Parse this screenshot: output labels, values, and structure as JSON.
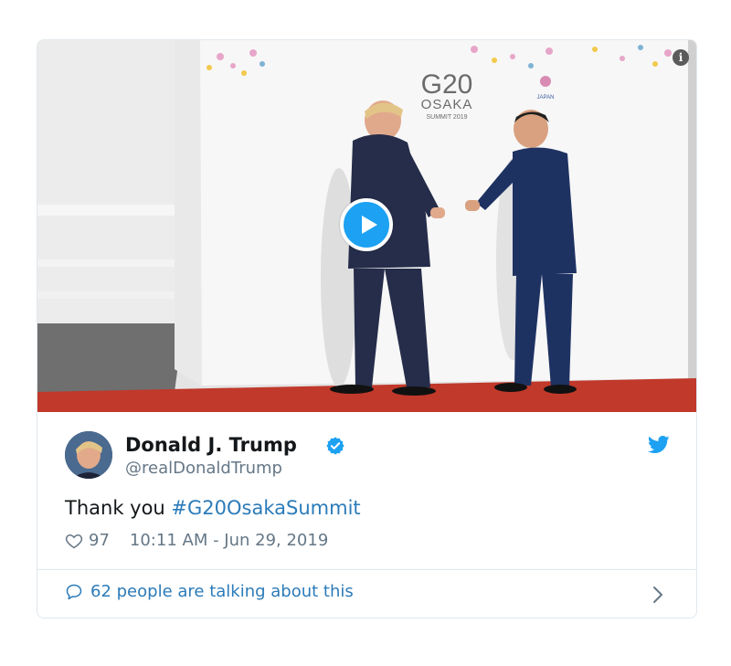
{
  "tweet": {
    "name": "Donald J. Trump",
    "handle": "@realDonaldTrump",
    "text_prefix": "Thank you ",
    "hashtag": "#G20OsakaSummit",
    "likes": "97",
    "timestamp": "10:11 AM - Jun 29, 2019",
    "talking": "62 people are talking about this"
  },
  "media": {
    "backdrop_title": "G20",
    "backdrop_subtitle": "OSAKA",
    "backdrop_caption": "SUMMIT 2019",
    "backdrop_logo_text": "G20 2019 JAPAN",
    "info_label": "i"
  },
  "colors": {
    "accent": "#1da1f2",
    "link": "#2b7bb9",
    "muted": "#657786",
    "text": "#14171a",
    "carpet": "#c0392b"
  }
}
